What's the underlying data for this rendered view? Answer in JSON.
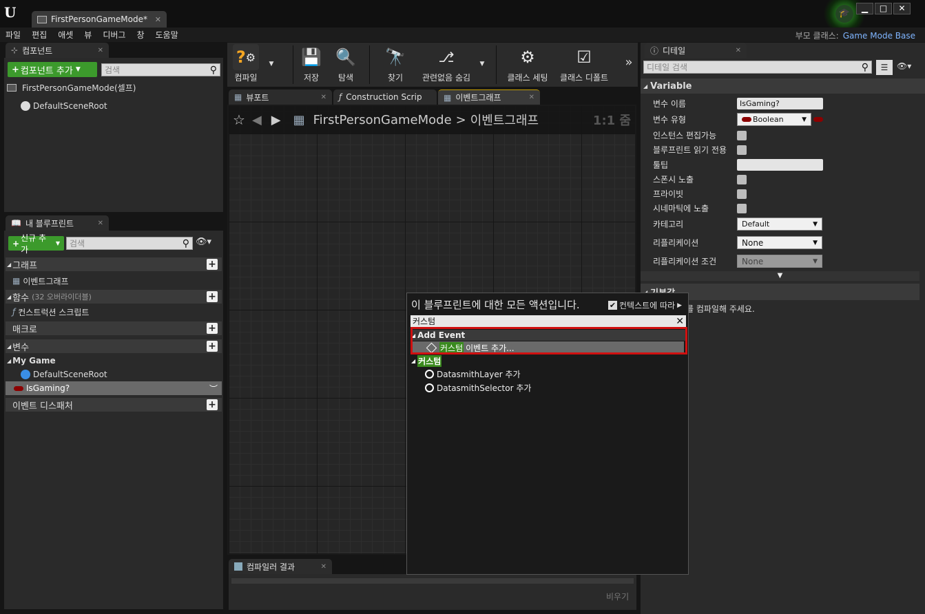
{
  "window": {
    "doc_tab_title": "FirstPersonGameMode*",
    "parent_class_label": "부모 클래스:",
    "parent_class_value": "Game Mode Base"
  },
  "menu": [
    "파일",
    "편집",
    "애셋",
    "뷰",
    "디버그",
    "창",
    "도움말"
  ],
  "components_panel": {
    "tab_label": "컴포넌트",
    "add_button": "컴포넌트 추가",
    "search_placeholder": "검색",
    "root_item": "FirstPersonGameMode(셀프)",
    "child_item": "DefaultSceneRoot"
  },
  "my_blueprint_panel": {
    "tab_label": "내 블루프린트",
    "add_new_button": "신규 추가",
    "search_placeholder": "검색",
    "graphs_label": "그래프",
    "graph_item": "이벤트그래프",
    "functions_label": "함수",
    "functions_override": "(32 오버라이더블)",
    "function_item": "컨스트럭션 스크립트",
    "macros_label": "매크로",
    "variables_label": "변수",
    "variable_group": "My Game",
    "var_item_1": "DefaultSceneRoot",
    "var_item_2": "IsGaming?",
    "dispatchers_label": "이벤트 디스패처"
  },
  "toolbar": {
    "compile": "컴파일",
    "save": "저장",
    "browse": "탐색",
    "find": "찾기",
    "hide_unrelated": "관련없음 숨김",
    "class_settings": "클래스 세팅",
    "class_defaults": "클래스 디폴트"
  },
  "editor_tabs": {
    "viewport": "뷰포트",
    "construction": "Construction Scrip",
    "event_graph": "이벤트그래프"
  },
  "graph": {
    "breadcrumb_root": "FirstPersonGameMode",
    "breadcrumb_sep": ">",
    "breadcrumb_current": "이벤트그래프",
    "zoom": "1:1 줌"
  },
  "details_panel": {
    "tab_label": "디테일",
    "search_placeholder": "디테일 검색",
    "variable_section": "Variable",
    "var_name_label": "변수 이름",
    "var_name_value": "IsGaming?",
    "var_type_label": "변수 유형",
    "var_type_value": "Boolean",
    "instance_editable": "인스턴스 편집가능",
    "bp_readonly": "블루프린트 읽기 전용",
    "tooltip": "툴팁",
    "expose_spawn": "스폰시 노출",
    "private": "프라이빗",
    "expose_cinematic": "시네마틱에 노출",
    "category_label": "카테고리",
    "category_value": "Default",
    "replication_label": "리플리케이션",
    "replication_value": "None",
    "replication_cond_label": "리플리케이션 조건",
    "replication_cond_value": "None",
    "default_section": "기본값",
    "compile_note": "를 컴파일해 주세요."
  },
  "action_popup": {
    "title": "이 블루프린트에 대한 모든 액션입니다.",
    "context_label": "컨텍스트에 따라",
    "search_value": "커스텀",
    "add_event_section": "Add Event",
    "custom_event_highlight": "커스텀",
    "custom_event_rest": "이벤트 추가...",
    "custom_section": "커스텀",
    "item_1": "DatasmithLayer 추가",
    "item_2": "DatasmithSelector 추가"
  },
  "compiler_panel": {
    "tab_label": "컴파일러 결과",
    "clear_button": "비우기"
  }
}
